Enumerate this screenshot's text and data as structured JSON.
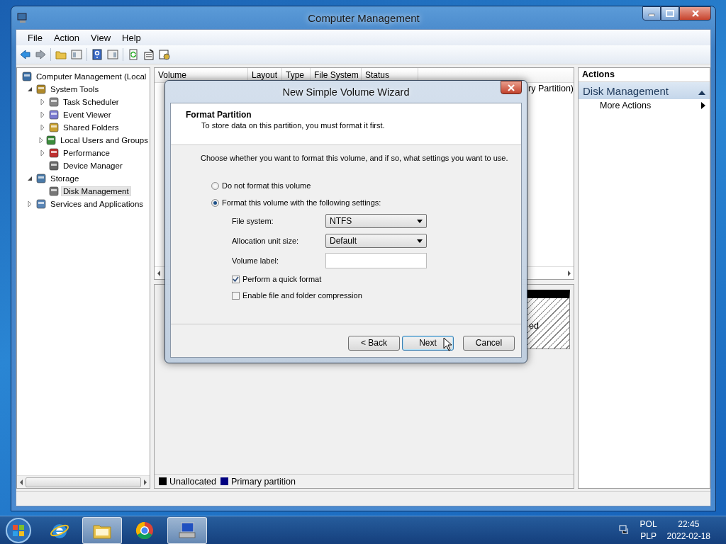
{
  "window": {
    "title": "Computer Management"
  },
  "menu": [
    "File",
    "Action",
    "View",
    "Help"
  ],
  "tree": [
    {
      "label": "Computer Management (Local",
      "selected": false,
      "children": [
        {
          "label": "System Tools",
          "selected": false,
          "expanded": true,
          "children": [
            {
              "label": "Task Scheduler",
              "selected": false,
              "expanded": false
            },
            {
              "label": "Event Viewer",
              "selected": false,
              "expanded": false
            },
            {
              "label": "Shared Folders",
              "selected": false,
              "expanded": false
            },
            {
              "label": "Local Users and Groups",
              "selected": false,
              "expanded": false
            },
            {
              "label": "Performance",
              "selected": false,
              "expanded": false
            },
            {
              "label": "Device Manager",
              "selected": false
            }
          ]
        },
        {
          "label": "Storage",
          "selected": false,
          "expanded": true,
          "children": [
            {
              "label": "Disk Management",
              "selected": true
            }
          ]
        },
        {
          "label": "Services and Applications",
          "selected": false,
          "expanded": false
        }
      ]
    }
  ],
  "volume_list": {
    "columns": [
      "Volume",
      "Layout",
      "Type",
      "File System",
      "Status"
    ],
    "fragment": "ry Partition)"
  },
  "disk_map": {
    "fragment": "ed",
    "legend": [
      {
        "label": "Unallocated",
        "color": "#000000"
      },
      {
        "label": "Primary partition",
        "color": "#000080"
      }
    ]
  },
  "actions": {
    "title": "Actions",
    "section": "Disk Management",
    "items": [
      "More Actions"
    ]
  },
  "dialog": {
    "title": "New Simple Volume Wizard",
    "header": "Format Partition",
    "subtitle": "To store data on this partition, you must format it first.",
    "instruction": "Choose whether you want to format this volume, and if so, what settings you want to use.",
    "options": [
      {
        "label": "Do not format this volume",
        "selected": false
      },
      {
        "label": "Format this volume with the following settings:",
        "selected": true
      }
    ],
    "fields": [
      {
        "kind": "dropdown",
        "label": "File system:",
        "value": "NTFS"
      },
      {
        "kind": "dropdown",
        "label": "Allocation unit size:",
        "value": "Default"
      },
      {
        "kind": "text",
        "label": "Volume label:"
      }
    ],
    "checkboxes": [
      {
        "label": "Perform a quick format",
        "checked": true
      },
      {
        "label": "Enable file and folder compression",
        "checked": false
      }
    ],
    "buttons": [
      {
        "label": "< Back",
        "default": false
      },
      {
        "label": "Next",
        "default": true
      },
      {
        "label": "Cancel",
        "default": false
      }
    ]
  },
  "taskbar": {
    "apps": [
      {
        "active": false
      },
      {
        "active": true
      },
      {
        "active": false
      },
      {
        "active": true
      }
    ],
    "language": "POL",
    "keyboard": "PLP",
    "time": "22:45",
    "date": "2022-02-18"
  }
}
